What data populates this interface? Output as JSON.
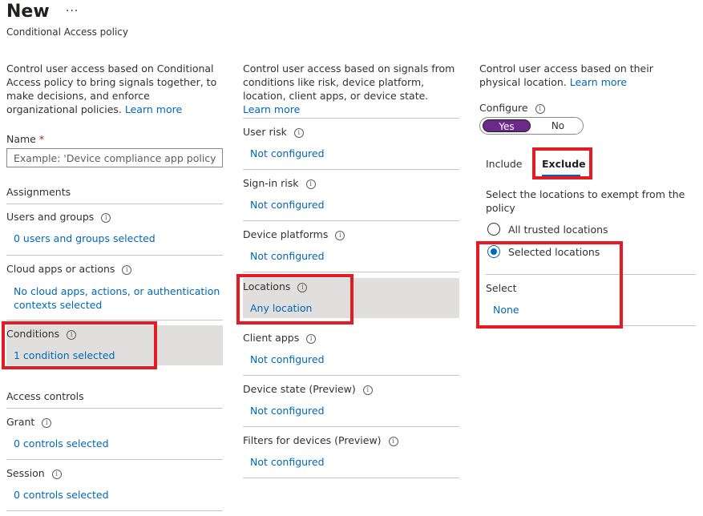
{
  "header": {
    "title": "New",
    "more_label": "···",
    "subtitle": "Conditional Access policy"
  },
  "left": {
    "intro_text": "Control user access based on Conditional Access policy to bring signals together, to make decisions, and enforce organizational policies.",
    "intro_link": "Learn more",
    "name_label": "Name",
    "name_required": "*",
    "name_placeholder": "Example: 'Device compliance app policy'",
    "assignments_heading": "Assignments",
    "users_label": "Users and groups",
    "users_value": "0 users and groups selected",
    "cloud_label": "Cloud apps or actions",
    "cloud_value": "No cloud apps, actions, or authentication contexts selected",
    "conditions_label": "Conditions",
    "conditions_value": "1 condition selected",
    "access_heading": "Access controls",
    "grant_label": "Grant",
    "grant_value": "0 controls selected",
    "session_label": "Session",
    "session_value": "0 controls selected"
  },
  "middle": {
    "intro_text": "Control user access based on signals from conditions like risk, device platform, location, client apps, or device state.",
    "intro_link": "Learn more",
    "items": [
      {
        "label": "User risk",
        "value": "Not configured"
      },
      {
        "label": "Sign-in risk",
        "value": "Not configured"
      },
      {
        "label": "Device platforms",
        "value": "Not configured"
      },
      {
        "label": "Locations",
        "value": "Any location"
      },
      {
        "label": "Client apps",
        "value": "Not configured"
      },
      {
        "label": "Device state (Preview)",
        "value": "Not configured"
      },
      {
        "label": "Filters for devices (Preview)",
        "value": "Not configured"
      }
    ]
  },
  "right": {
    "intro_text": "Control user access based on their physical location.",
    "intro_link": "Learn more",
    "configure_label": "Configure",
    "toggle_yes": "Yes",
    "toggle_no": "No",
    "tab_include": "Include",
    "tab_exclude": "Exclude",
    "exclude_description": "Select the locations to exempt from the policy",
    "radio_all": "All trusted locations",
    "radio_selected": "Selected locations",
    "select_label": "Select",
    "select_value": "None"
  },
  "colors": {
    "link": "#0067b8",
    "highlight_bg": "#e1dfdd",
    "annotation_red": "#e51b24",
    "toggle_on": "#6b2a8a"
  },
  "icons": {
    "info": "info-circle-icon",
    "more": "more-ellipsis-icon"
  }
}
